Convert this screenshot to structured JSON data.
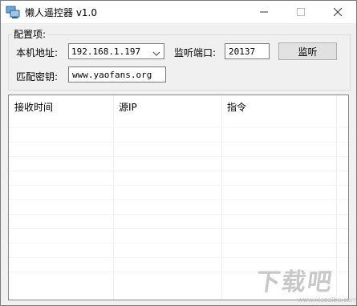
{
  "window": {
    "title": "懒人遥控器 v1.0",
    "controls": {
      "minimize": "—",
      "maximize": "☐",
      "close": "✕"
    }
  },
  "config": {
    "group_label": "配置项:",
    "local_ip_label": "本机地址:",
    "local_ip_value": "192.168.1.197",
    "port_label": "监听端口:",
    "port_value": "20137",
    "listen_button": "监听",
    "key_label": "匹配密钥:",
    "key_value": "www.yaofans.org"
  },
  "table": {
    "columns": [
      "接收时间",
      "源IP",
      "指令"
    ],
    "rows": []
  },
  "watermark": {
    "text": "下载吧",
    "url": "www.xiazaiba.com"
  },
  "colors": {
    "titlebar": "#ffffff",
    "window_bg": "#f0f0f0",
    "button_bg": "#e1e1e1"
  },
  "icons": {
    "app": "computer-network-icon",
    "select_arrow": "chevron-down-icon"
  }
}
